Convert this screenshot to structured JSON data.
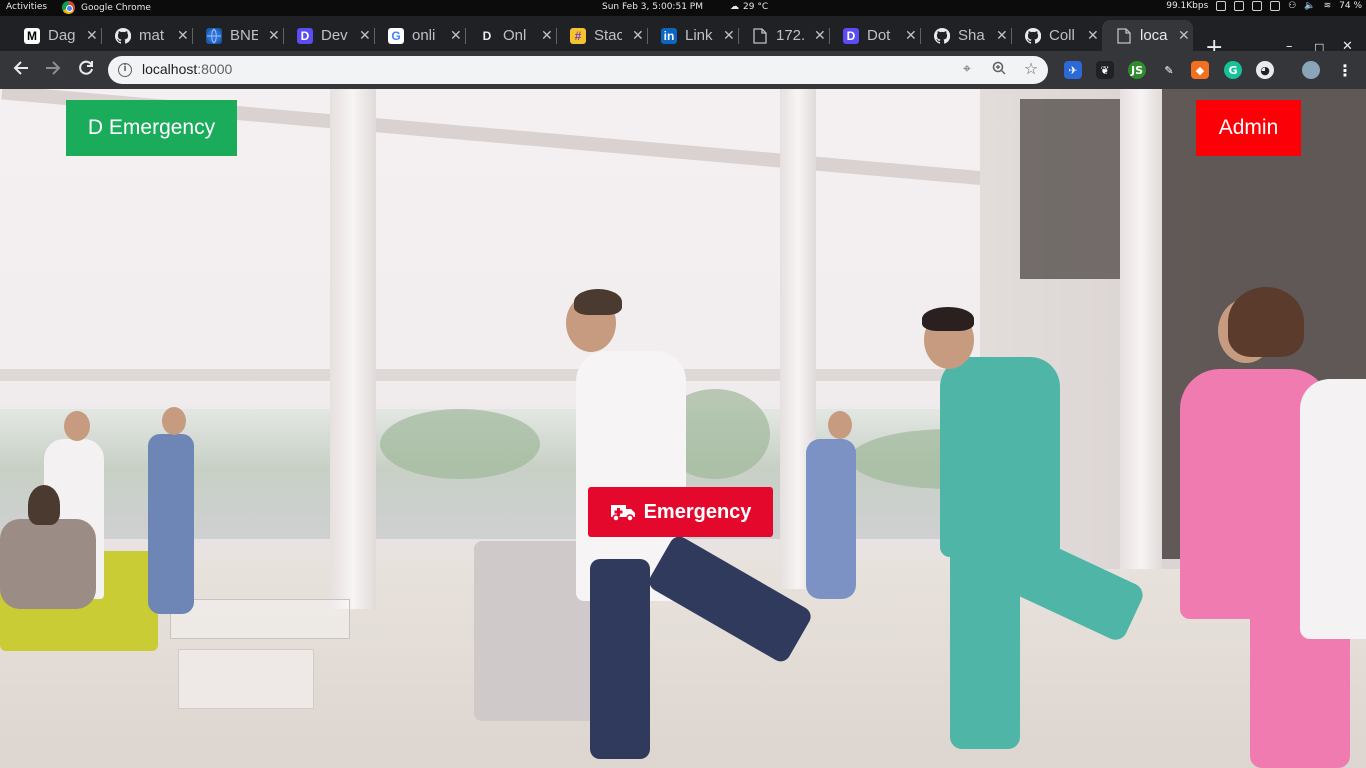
{
  "system_bar": {
    "activities": "Activities",
    "app_name": "Google Chrome",
    "clock": "Sun Feb 3,  5:00:51 PM",
    "weather": "29 °C",
    "network_speed": "99.1Kbps",
    "battery": "74 %"
  },
  "browser": {
    "tabs": [
      {
        "title": "Dag",
        "favicon": "M",
        "favicon_bg": "#ffffff",
        "favicon_fg": "#000000"
      },
      {
        "title": "mat",
        "favicon": "github-icon",
        "favicon_bg": "#202124",
        "favicon_fg": "#e8eaed"
      },
      {
        "title": "BNE",
        "favicon": "globe-icon",
        "favicon_bg": "#1c5aa8",
        "favicon_fg": "#ffffff"
      },
      {
        "title": "Dev",
        "favicon": "D",
        "favicon_bg": "#5b4cf5",
        "favicon_fg": "#ffffff"
      },
      {
        "title": "onli",
        "favicon": "G",
        "favicon_bg": "#ffffff",
        "favicon_fg": "#4285f4"
      },
      {
        "title": "Onl",
        "favicon": "D",
        "favicon_bg": "#202124",
        "favicon_fg": "#e8eaed"
      },
      {
        "title": "Stac",
        "favicon": "#",
        "favicon_bg": "#f4c430",
        "favicon_fg": "#7a3fb5"
      },
      {
        "title": "Link",
        "favicon": "in",
        "favicon_bg": "#0a66c2",
        "favicon_fg": "#ffffff"
      },
      {
        "title": "172.",
        "favicon": "page-icon",
        "favicon_bg": "#202124",
        "favicon_fg": "#bdc1c6"
      },
      {
        "title": "Dot",
        "favicon": "D",
        "favicon_bg": "#5b4cf5",
        "favicon_fg": "#ffffff"
      },
      {
        "title": "Sha",
        "favicon": "github-icon",
        "favicon_bg": "#202124",
        "favicon_fg": "#e8eaed"
      },
      {
        "title": "Coll",
        "favicon": "github-icon",
        "favicon_bg": "#202124",
        "favicon_fg": "#e8eaed"
      },
      {
        "title": "loca",
        "favicon": "page-icon",
        "favicon_bg": "#35363a",
        "favicon_fg": "#bdc1c6"
      }
    ],
    "active_tab_index": 12,
    "new_tab_label": "+",
    "address_bar": {
      "host": "localhost",
      "port": ":8000"
    },
    "window_controls": {
      "minimize": "–",
      "maximize": "□",
      "close": "✕"
    }
  },
  "page": {
    "brand_label": "D Emergency",
    "brand_color": "#1aab5b",
    "admin_label": "Admin",
    "admin_color": "#fb0006",
    "emergency_label": "Emergency",
    "emergency_icon": "ambulance-icon",
    "emergency_color": "#e4082d"
  }
}
